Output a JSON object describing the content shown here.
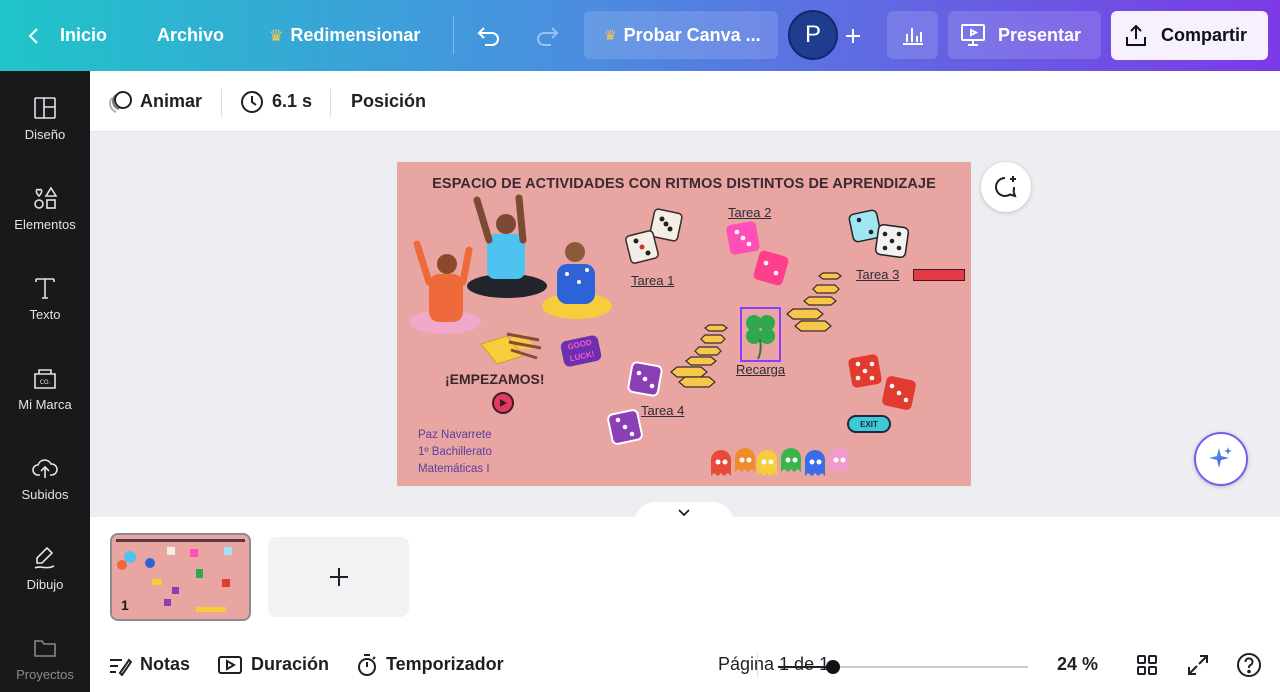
{
  "topbar": {
    "back_label": "Inicio",
    "file_label": "Archivo",
    "resize_label": "Redimensionar",
    "promo_label": "Probar Canva ...",
    "avatar_initial": "P",
    "present_label": "Presentar",
    "share_label": "Compartir"
  },
  "sidebar": {
    "items": [
      {
        "label": "Diseño",
        "icon": "layout-icon"
      },
      {
        "label": "Elementos",
        "icon": "shapes-icon"
      },
      {
        "label": "Texto",
        "icon": "text-icon"
      },
      {
        "label": "Mi Marca",
        "icon": "brand-icon"
      },
      {
        "label": "Subidos",
        "icon": "upload-cloud-icon"
      },
      {
        "label": "Dibujo",
        "icon": "draw-icon"
      },
      {
        "label": "Proyectos",
        "icon": "folder-icon"
      }
    ]
  },
  "toolbar": {
    "animate_label": "Animar",
    "duration_value": "6.1 s",
    "position_label": "Posición"
  },
  "slide": {
    "title": "ESPACIO DE ACTIVIDADES CON RITMOS DISTINTOS DE APRENDIZAJE",
    "task1": "Tarea 1",
    "task2": "Tarea 2",
    "task3": "Tarea 3",
    "task4": "Tarea 4",
    "recharge": "Recarga",
    "start": "¡EMPEZAMOS!",
    "sticker": "GOOD LUCK!",
    "exit": "EXIT",
    "author_name": "Paz Navarrete",
    "author_course": "1º Bachillerato",
    "author_subject": "Matemáticas I",
    "background_color": "#e8a5a1"
  },
  "pages": {
    "thumb_number": "1"
  },
  "footer": {
    "notes_label": "Notas",
    "duration_label": "Duración",
    "timer_label": "Temporizador",
    "page_indicator": "Página 1 de 1",
    "zoom_label": "24 %",
    "zoom_fraction": 0.22
  }
}
